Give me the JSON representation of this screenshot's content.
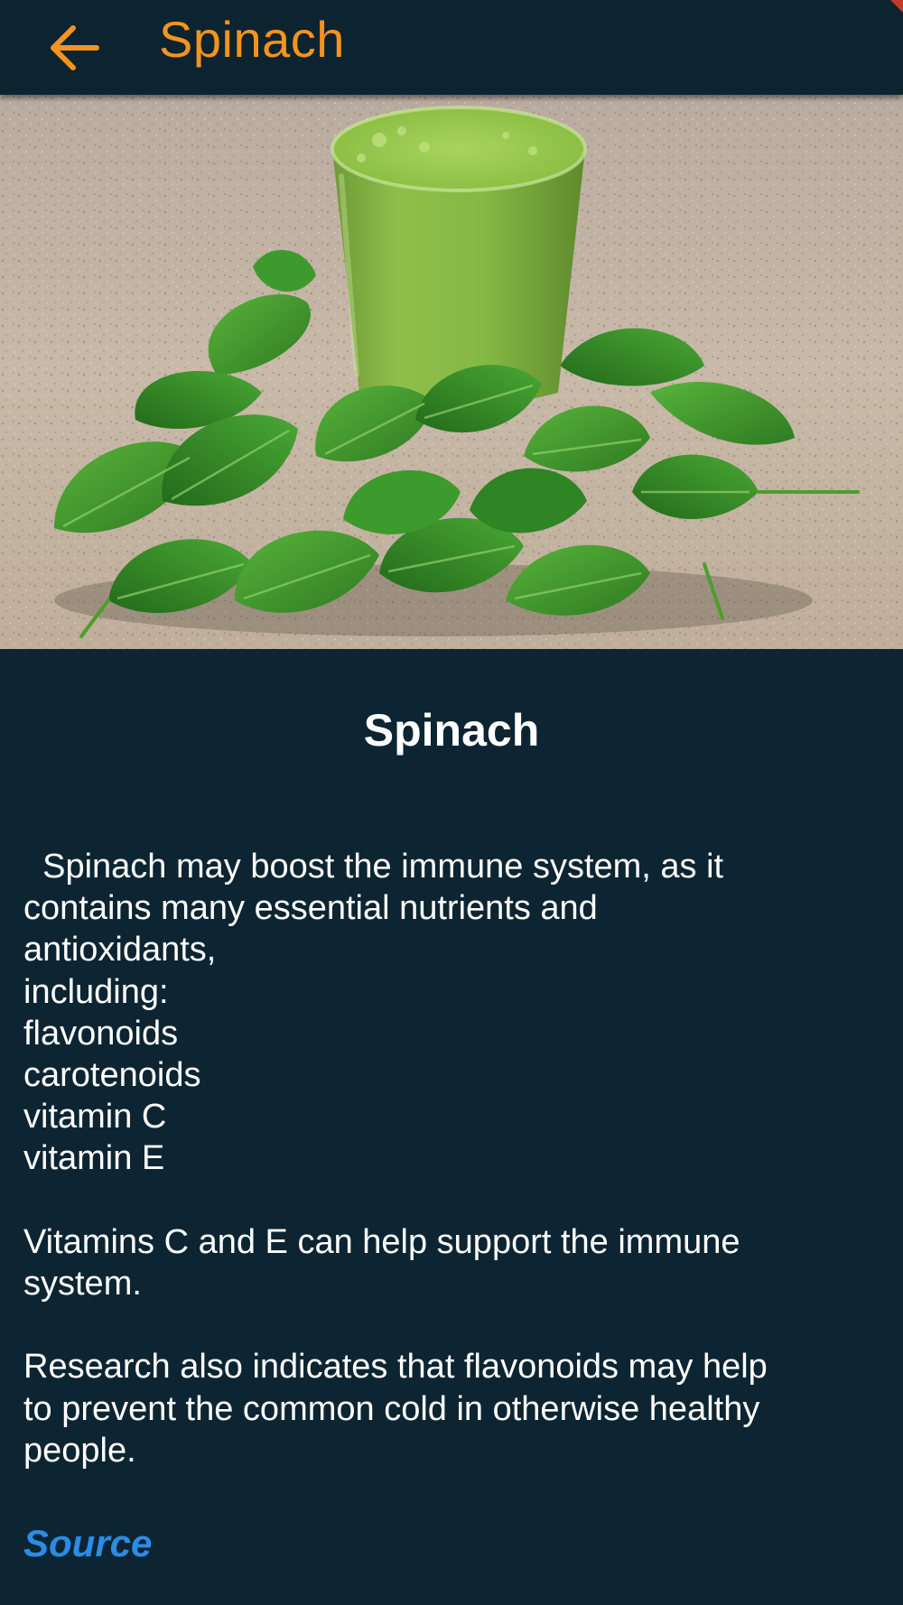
{
  "app_bar": {
    "title": "Spinach",
    "accent_color": "#f5931e",
    "back_icon": "arrow-left-icon"
  },
  "hero_image": {
    "alt": "Green spinach smoothie in a glass surrounded by fresh spinach leaves"
  },
  "content": {
    "title": "Spinach",
    "paragraph_lines": [
      "  Spinach may boost the immune system, as it",
      "contains many essential nutrients and",
      "antioxidants,",
      "including:",
      "flavonoids",
      "carotenoids",
      "vitamin C",
      "vitamin E",
      "",
      "Vitamins C and E can help support the immune",
      "system.",
      "",
      "Research also indicates that flavonoids may help",
      "to prevent the common cold in otherwise healthy",
      "people."
    ],
    "source_label": "Source",
    "source_color": "#2a8ce6"
  }
}
